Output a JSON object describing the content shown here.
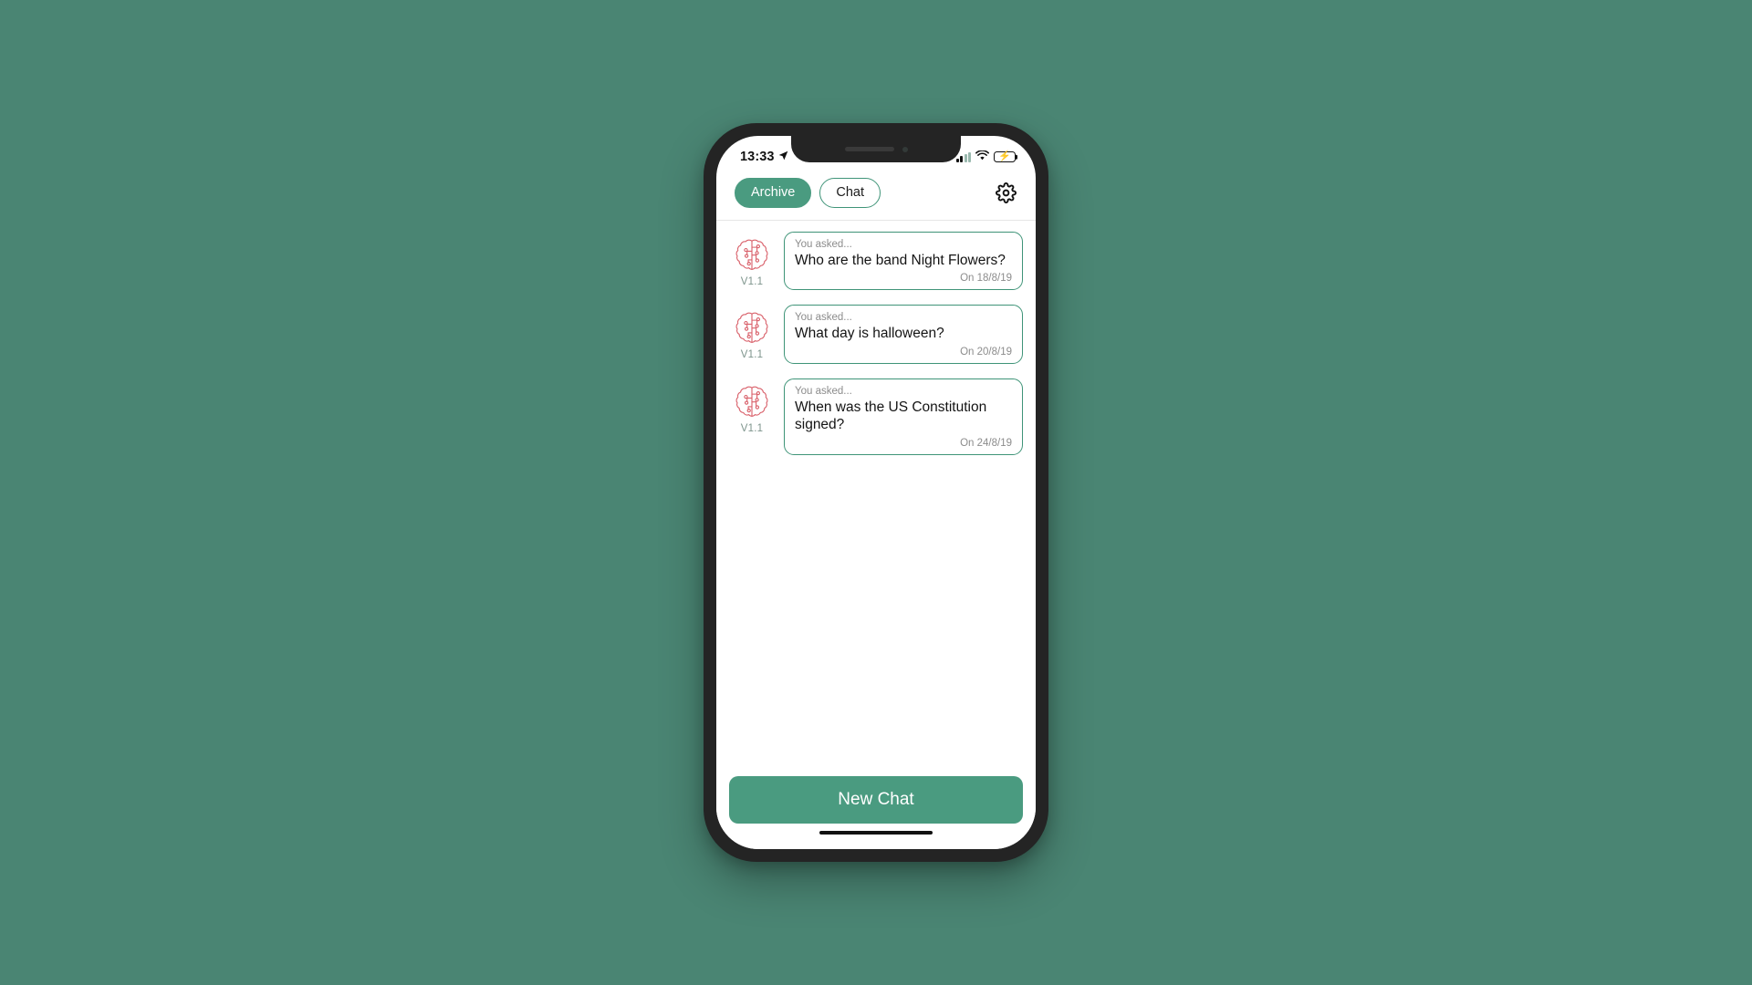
{
  "theme": {
    "page_background": "#4a8573",
    "accent_green": "#4a9b80",
    "border_green": "#3f9478",
    "brain_red": "#d9606a",
    "muted_text": "#8c8c8c",
    "version_text": "#7d948c"
  },
  "status_bar": {
    "time": "13:33",
    "location_icon": "location-arrow-icon",
    "signal_icon": "cellular-signal-icon",
    "wifi_icon": "wifi-icon",
    "battery_icon": "battery-charging-icon",
    "battery_bolt": "⚡"
  },
  "header": {
    "tabs": [
      {
        "label": "Archive",
        "active": true,
        "name": "tab-archive"
      },
      {
        "label": "Chat",
        "active": false,
        "name": "tab-chat"
      }
    ],
    "settings_icon": "gear-icon"
  },
  "chat_list": {
    "items": [
      {
        "avatar_icon": "brain-circuit-icon",
        "version": "V1.1",
        "label": "You asked...",
        "question": "Who are the band Night Flowers?",
        "date": "On 18/8/19"
      },
      {
        "avatar_icon": "brain-circuit-icon",
        "version": "V1.1",
        "label": "You asked...",
        "question": "What day is halloween?",
        "date": "On 20/8/19"
      },
      {
        "avatar_icon": "brain-circuit-icon",
        "version": "V1.1",
        "label": "You asked...",
        "question": "When was the US Constitution signed?",
        "date": "On 24/8/19"
      }
    ]
  },
  "footer": {
    "new_chat_label": "New Chat"
  }
}
